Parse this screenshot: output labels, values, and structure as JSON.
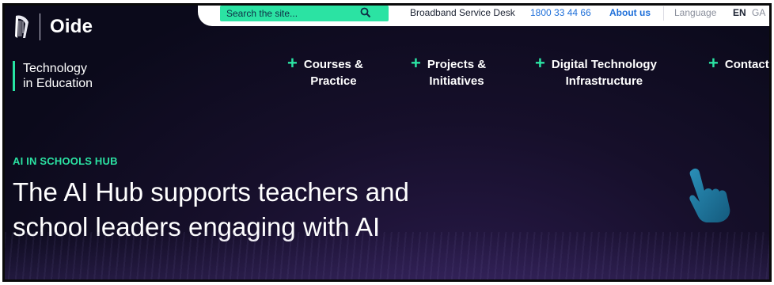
{
  "brand": {
    "name": "Oide",
    "tagline_line1": "Technology",
    "tagline_line2": "in Education",
    "accent_color": "#2be3a3"
  },
  "utility_bar": {
    "search_placeholder": "Search the site...",
    "broadband_label": "Broadband Service Desk",
    "broadband_phone": "1800 33 44 66",
    "about_label": "About us",
    "language_label": "Language",
    "lang_en": "EN",
    "lang_ga": "GA"
  },
  "nav": {
    "items": [
      {
        "line1": "Courses &",
        "line2": "Practice"
      },
      {
        "line1": "Projects &",
        "line2": "Initiatives"
      },
      {
        "line1": "Digital Technology",
        "line2": "Infrastructure"
      },
      {
        "line1": "Contact",
        "line2": ""
      }
    ]
  },
  "hero": {
    "eyebrow": "AI IN SCHOOLS HUB",
    "headline_line1": "The AI Hub supports teachers and",
    "headline_line2": "school leaders engaging with AI"
  },
  "icons": {
    "search": "search-icon",
    "harp": "harp-logo-icon",
    "hand": "pointing-hand-icon",
    "plus": "plus-icon"
  }
}
